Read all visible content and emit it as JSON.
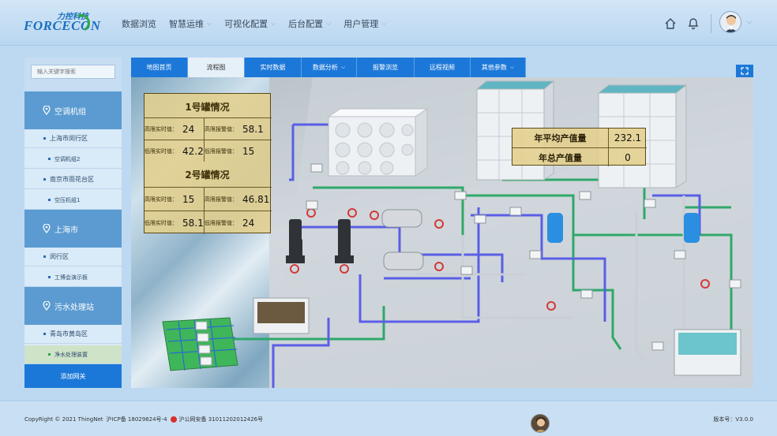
{
  "brand": {
    "logo_cn": "力控科技",
    "logo_en": "FORCECON"
  },
  "nav": [
    {
      "label": "数据浏览",
      "has_caret": false
    },
    {
      "label": "智慧运维",
      "has_caret": true
    },
    {
      "label": "可视化配置",
      "has_caret": true
    },
    {
      "label": "后台配置",
      "has_caret": true
    },
    {
      "label": "用户管理",
      "has_caret": true
    }
  ],
  "sidebar": {
    "search_placeholder": "输入关键字搜索",
    "groups": [
      {
        "label": "空调机组",
        "items": [
          {
            "label": "上海市闵行区",
            "level": 1
          },
          {
            "label": "空调机组2",
            "level": 2
          },
          {
            "label": "南京市雨花台区",
            "level": 1
          },
          {
            "label": "空压机组1",
            "level": 2
          }
        ]
      },
      {
        "label": "上海市",
        "items": [
          {
            "label": "闵行区",
            "level": 1
          },
          {
            "label": "工博会演示板",
            "level": 2
          }
        ]
      },
      {
        "label": "污水处理站",
        "items": [
          {
            "label": "青岛市黄岛区",
            "level": 1
          },
          {
            "label": "净水处理装置",
            "level": 2,
            "active": true
          }
        ]
      }
    ],
    "add_gateway": "添加网关"
  },
  "tabs": [
    {
      "label": "地图首页",
      "active": false,
      "has_caret": false
    },
    {
      "label": "流程图",
      "active": true,
      "has_caret": false
    },
    {
      "label": "实时数据",
      "active": false,
      "has_caret": false
    },
    {
      "label": "数据分析",
      "active": false,
      "has_caret": true
    },
    {
      "label": "报警浏览",
      "active": false,
      "has_caret": false
    },
    {
      "label": "远程视频",
      "active": false,
      "has_caret": false
    },
    {
      "label": "其他参数",
      "active": false,
      "has_caret": true
    }
  ],
  "tank_panel": {
    "tank1": {
      "title": "1号罐情况",
      "high_realtime_label": "高限实时值：",
      "high_realtime": "24",
      "high_alarm_label": "高限报警值：",
      "high_alarm": "58.1",
      "low_realtime_label": "低限实时值：",
      "low_realtime": "42.2",
      "low_alarm_label": "低限报警值：",
      "low_alarm": "15"
    },
    "tank2": {
      "title": "2号罐情况",
      "high_realtime_label": "高限实时值：",
      "high_realtime": "15",
      "high_alarm_label": "高限报警值：",
      "high_alarm": "46.81",
      "low_realtime_label": "低限实时值：",
      "low_realtime": "58.1",
      "low_alarm_label": "低限报警值：",
      "low_alarm": "24"
    }
  },
  "output_panel": {
    "avg_label": "年平均产值量",
    "avg_value": "232.1",
    "total_label": "年总产值量",
    "total_value": "0"
  },
  "footer": {
    "copyright": "CopyRight © 2021 ThingNet",
    "icp": "沪ICP备 18029824号-4",
    "police": "沪公网安备 31011202012426号",
    "version": "版本号：V3.0.0"
  },
  "colors": {
    "primary": "#1c78d8",
    "sidebar_group": "#5b9bd1",
    "panel_bg": "#e2cf8c",
    "pipe_green": "#2fa86a",
    "pipe_blue": "#5a5ee6"
  }
}
